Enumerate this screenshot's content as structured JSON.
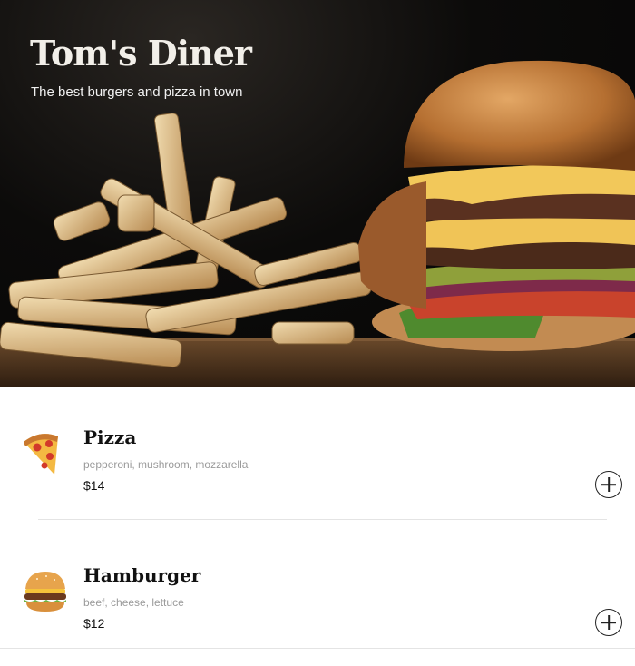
{
  "header": {
    "title": "Tom's Diner",
    "tagline": "The best burgers and pizza in town"
  },
  "menu": {
    "items": [
      {
        "icon": "pizza-icon",
        "name": "Pizza",
        "ingredients": "pepperoni, mushroom, mozzarella",
        "price": "$14"
      },
      {
        "icon": "hamburger-icon",
        "name": "Hamburger",
        "ingredients": "beef, cheese, lettuce",
        "price": "$12"
      }
    ]
  },
  "colors": {
    "hero_background": "#050505",
    "title_text": "#f2efe9",
    "ingredients_text": "#9a9a9a",
    "divider": "#e4e4e4"
  }
}
